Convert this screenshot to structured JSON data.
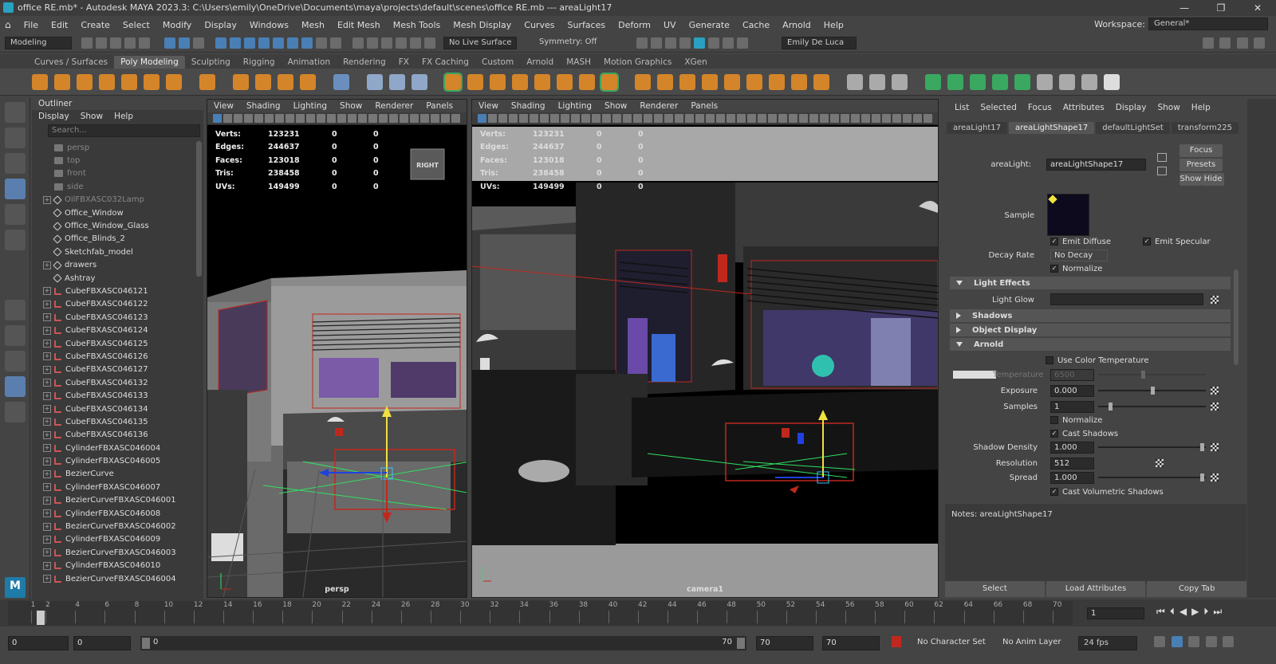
{
  "window": {
    "title": "office RE.mb* - Autodesk MAYA 2023.3: C:\\Users\\emily\\OneDrive\\Documents\\maya\\projects\\default\\scenes\\office RE.mb   ---   areaLight17"
  },
  "menu": [
    "File",
    "Edit",
    "Create",
    "Select",
    "Modify",
    "Display",
    "Windows",
    "Mesh",
    "Edit Mesh",
    "Mesh Tools",
    "Mesh Display",
    "Curves",
    "Surfaces",
    "Deform",
    "UV",
    "Generate",
    "Cache",
    "Arnold",
    "Help"
  ],
  "workspace": {
    "label": "Workspace:",
    "value": "General*"
  },
  "status": {
    "mode": "Modeling",
    "live_surface": "No Live Surface",
    "symmetry": "Symmetry: Off",
    "user": "Emily De Luca"
  },
  "shelf_tabs": [
    "Curves / Surfaces",
    "Poly Modeling",
    "Sculpting",
    "Rigging",
    "Animation",
    "Rendering",
    "FX",
    "FX Caching",
    "Custom",
    "Arnold",
    "MASH",
    "Motion Graphics",
    "XGen"
  ],
  "outliner": {
    "title": "Outliner",
    "menu": [
      "Display",
      "Show",
      "Help"
    ],
    "search_placeholder": "Search...",
    "items": [
      {
        "label": "persp",
        "dim": true,
        "exp": false
      },
      {
        "label": "top",
        "dim": true,
        "exp": false
      },
      {
        "label": "front",
        "dim": true,
        "exp": false
      },
      {
        "label": "side",
        "dim": true,
        "exp": false
      },
      {
        "label": "OilFBXASC032Lamp",
        "dim": true,
        "exp": true
      },
      {
        "label": "Office_Window",
        "exp": false
      },
      {
        "label": "Office_Window_Glass",
        "exp": false
      },
      {
        "label": "Office_Blinds_2",
        "exp": false
      },
      {
        "label": "Sketchfab_model",
        "exp": false
      },
      {
        "label": "drawers",
        "exp": true
      },
      {
        "label": "Ashtray",
        "exp": false
      },
      {
        "label": "CubeFBXASC046121",
        "exp": true
      },
      {
        "label": "CubeFBXASC046122",
        "exp": true
      },
      {
        "label": "CubeFBXASC046123",
        "exp": true
      },
      {
        "label": "CubeFBXASC046124",
        "exp": true
      },
      {
        "label": "CubeFBXASC046125",
        "exp": true
      },
      {
        "label": "CubeFBXASC046126",
        "exp": true
      },
      {
        "label": "CubeFBXASC046127",
        "exp": true
      },
      {
        "label": "CubeFBXASC046132",
        "exp": true
      },
      {
        "label": "CubeFBXASC046133",
        "exp": true
      },
      {
        "label": "CubeFBXASC046134",
        "exp": true
      },
      {
        "label": "CubeFBXASC046135",
        "exp": true
      },
      {
        "label": "CubeFBXASC046136",
        "exp": true
      },
      {
        "label": "CylinderFBXASC046004",
        "exp": true
      },
      {
        "label": "CylinderFBXASC046005",
        "exp": true
      },
      {
        "label": "BezierCurve",
        "exp": true
      },
      {
        "label": "CylinderFBXASC046007",
        "exp": true
      },
      {
        "label": "BezierCurveFBXASC046001",
        "exp": true
      },
      {
        "label": "CylinderFBXASC046008",
        "exp": true
      },
      {
        "label": "BezierCurveFBXASC046002",
        "exp": true
      },
      {
        "label": "CylinderFBXASC046009",
        "exp": true
      },
      {
        "label": "BezierCurveFBXASC046003",
        "exp": true
      },
      {
        "label": "CylinderFBXASC046010",
        "exp": true
      },
      {
        "label": "BezierCurveFBXASC046004",
        "exp": true
      }
    ]
  },
  "viewport_menu": [
    "View",
    "Shading",
    "Lighting",
    "Show",
    "Renderer",
    "Panels"
  ],
  "hud": [
    {
      "label": "Verts:",
      "a": "123231",
      "b": "0",
      "c": "0"
    },
    {
      "label": "Edges:",
      "a": "244637",
      "b": "0",
      "c": "0"
    },
    {
      "label": "Faces:",
      "a": "123018",
      "b": "0",
      "c": "0"
    },
    {
      "label": "Tris:",
      "a": "238458",
      "b": "0",
      "c": "0"
    },
    {
      "label": "UVs:",
      "a": "149499",
      "b": "0",
      "c": "0"
    }
  ],
  "viewports": {
    "left_camera": "persp",
    "right_camera": "camera1",
    "viewcube": "RIGHT"
  },
  "attr": {
    "menu": [
      "List",
      "Selected",
      "Focus",
      "Attributes",
      "Display",
      "Show",
      "Help"
    ],
    "tabs": [
      "areaLight17",
      "areaLightShape17",
      "defaultLightSet",
      "transform225"
    ],
    "node_label": "areaLight:",
    "node_value": "areaLightShape17",
    "buttons": {
      "focus": "Focus",
      "presets": "Presets",
      "show": "Show",
      "hide": "Hide"
    },
    "sample_label": "Sample",
    "emit_diffuse": "Emit Diffuse",
    "emit_specular": "Emit Specular",
    "decay_label": "Decay Rate",
    "decay_value": "No Decay",
    "normalize": "Normalize",
    "light_effects": "Light Effects",
    "light_glow": "Light Glow",
    "shadows": "Shadows",
    "object_display": "Object Display",
    "arnold": "Arnold",
    "use_color_temp": "Use Color Temperature",
    "temperature_label": "Temperature",
    "temperature_value": "6500",
    "exposure_label": "Exposure",
    "exposure_value": "0.000",
    "samples_label": "Samples",
    "samples_value": "1",
    "normalize2": "Normalize",
    "cast_shadows": "Cast Shadows",
    "shadow_density_label": "Shadow Density",
    "shadow_density_value": "1.000",
    "resolution_label": "Resolution",
    "resolution_value": "512",
    "spread_label": "Spread",
    "spread_value": "1.000",
    "cast_vol": "Cast Volumetric Shadows",
    "notes": "Notes:  areaLightShape17",
    "bottom": [
      "Select",
      "Load Attributes",
      "Copy Tab"
    ]
  },
  "timeline": {
    "ticks": [
      "1",
      "2",
      "4",
      "6",
      "8",
      "10",
      "12",
      "14",
      "16",
      "18",
      "20",
      "22",
      "24",
      "26",
      "28",
      "30",
      "32",
      "34",
      "36",
      "38",
      "40",
      "42",
      "44",
      "46",
      "48",
      "50",
      "52",
      "54",
      "56",
      "58",
      "60",
      "62",
      "64",
      "66",
      "68",
      "70"
    ],
    "current_frame": "1"
  },
  "range": {
    "start": "0",
    "anim_start": "0",
    "slider_start": "0",
    "slider_end": "70",
    "end1": "70",
    "end2": "70",
    "character_set": "No Character Set",
    "anim_layer": "No Anim Layer",
    "fps": "24 fps"
  },
  "colors": {
    "accent": "#5a7fae",
    "light_red": "#c0281e",
    "gizmo_yellow": "#f0e040",
    "gizmo_green": "#30e060",
    "gizmo_blue": "#2040e0"
  }
}
